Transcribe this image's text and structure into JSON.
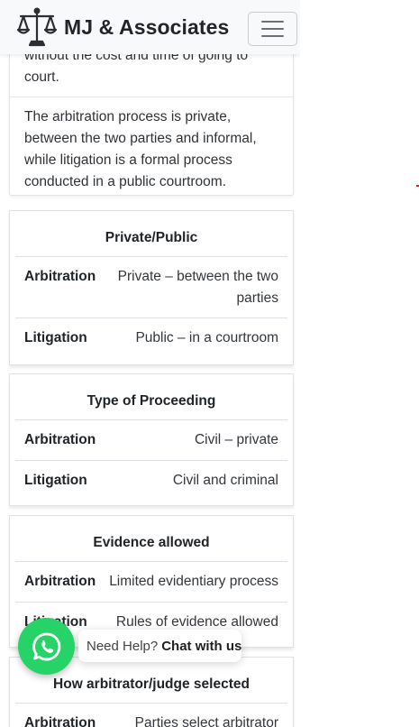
{
  "brand": {
    "name": "MJ & Associates",
    "icon": "scales-of-justice-icon"
  },
  "nav": {
    "toggle_icon": "hamburger-menu-icon"
  },
  "text_card": {
    "para1": "without the cost and time of going to court.",
    "para2": "The arbitration process is private, between the two parties and informal, while litigation is a formal process conducted in a public courtroom."
  },
  "comparisons": [
    {
      "heading": "Private/Public",
      "rows": [
        {
          "label": "Arbitration",
          "value": "Private – between the two parties"
        },
        {
          "label": "Litigation",
          "value": "Public – in a courtroom"
        }
      ]
    },
    {
      "heading": "Type of Proceeding",
      "rows": [
        {
          "label": "Arbitration",
          "value": "Civil – private"
        },
        {
          "label": "Litigation",
          "value": "Civil and criminal"
        }
      ]
    },
    {
      "heading": "Evidence allowed",
      "rows": [
        {
          "label": "Arbitration",
          "value": "Limited evidentiary process"
        },
        {
          "label": "Litigation",
          "value": "Rules of evidence allowed"
        }
      ]
    },
    {
      "heading": "How arbitrator/judge selected",
      "rows": [
        {
          "label": "Arbitration",
          "value": "Parties select arbitrator"
        }
      ]
    }
  ],
  "whatsapp": {
    "prefix": "Need Help?",
    "cta": "Chat with us",
    "icon": "whatsapp-icon",
    "color": "#25d366"
  }
}
